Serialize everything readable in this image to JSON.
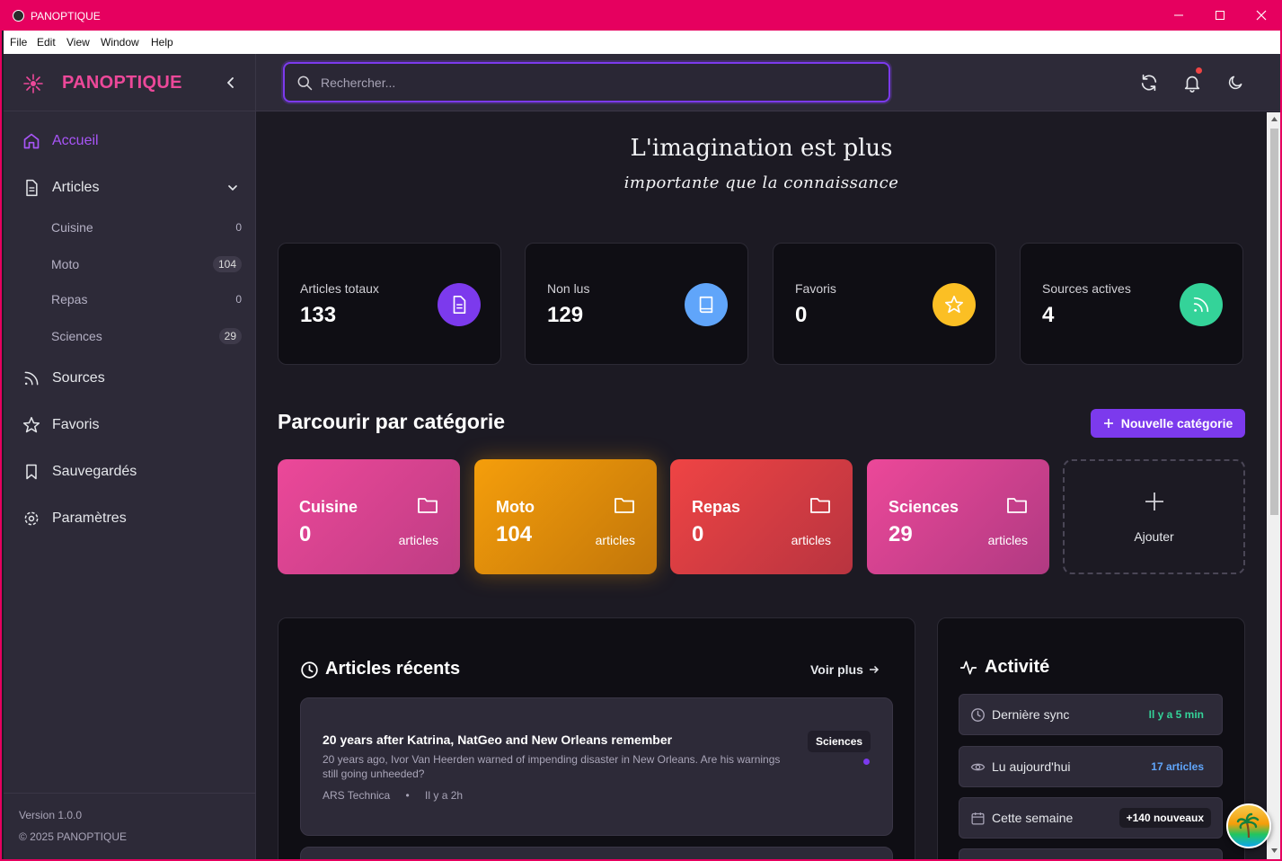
{
  "window": {
    "title": "PANOPTIQUE"
  },
  "menu": [
    "File",
    "Edit",
    "View",
    "Window",
    "Help"
  ],
  "sidebar": {
    "brand": "PANOPTIQUE",
    "items": {
      "home": "Accueil",
      "articles": "Articles",
      "sources": "Sources",
      "favorites": "Favoris",
      "saved": "Sauvegardés",
      "settings": "Paramètres"
    },
    "subitems": [
      {
        "label": "Cuisine",
        "count": "0"
      },
      {
        "label": "Moto",
        "count": "104"
      },
      {
        "label": "Repas",
        "count": "0"
      },
      {
        "label": "Sciences",
        "count": "29"
      }
    ],
    "version": "Version 1.0.0",
    "copyright": "© 2025 PANOPTIQUE"
  },
  "search": {
    "placeholder": "Rechercher..."
  },
  "quote": {
    "line1": "L'imagination est plus",
    "line2": "importante que la connaissance"
  },
  "stats": [
    {
      "label": "Articles totaux",
      "value": "133",
      "icon": "document-icon",
      "color": "#7c3aed"
    },
    {
      "label": "Non lus",
      "value": "129",
      "icon": "book-icon",
      "color": "#60a5fa"
    },
    {
      "label": "Favoris",
      "value": "0",
      "icon": "star-icon",
      "color": "#fbbf24"
    },
    {
      "label": "Sources actives",
      "value": "4",
      "icon": "rss-icon",
      "color": "#34d399"
    }
  ],
  "categories": {
    "title": "Parcourir par catégorie",
    "new_button": "Nouvelle catégorie",
    "add_label": "Ajouter",
    "items": [
      {
        "name": "Cuisine",
        "count": "0",
        "sub": "articles",
        "colors": [
          "#ec4899",
          "#be3d84"
        ]
      },
      {
        "name": "Moto",
        "count": "104",
        "sub": "articles",
        "colors": [
          "#f59e0b",
          "#c2760a"
        ]
      },
      {
        "name": "Repas",
        "count": "0",
        "sub": "articles",
        "colors": [
          "#ef4444",
          "#b83440"
        ]
      },
      {
        "name": "Sciences",
        "count": "29",
        "sub": "articles",
        "colors": [
          "#ec4899",
          "#b03a82"
        ]
      }
    ]
  },
  "recent": {
    "title": "Articles récents",
    "more": "Voir plus",
    "articles": [
      {
        "title": "20 years after Katrina, NatGeo and New Orleans remember",
        "description": "20 years ago, Ivor Van Heerden warned of impending disaster in New Orleans. Are his warnings still going unheeded?",
        "source": "ARS Technica",
        "separator": "•",
        "time": "Il y a 2h",
        "tag": "Sciences"
      }
    ]
  },
  "activity": {
    "title": "Activité",
    "items": [
      {
        "label": "Dernière sync",
        "value": "Il y a 5 min",
        "color": "#34d399"
      },
      {
        "label": "Lu aujourd'hui",
        "value": "17 articles",
        "color": "#60a5fa"
      },
      {
        "label": "Cette semaine",
        "value": "+140 nouveaux",
        "color": "#ffffff"
      }
    ]
  }
}
